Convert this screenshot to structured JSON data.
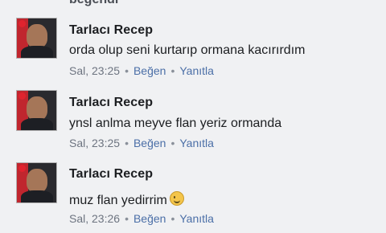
{
  "header_cut_text": "beğendi",
  "comments": [
    {
      "author": "Tarlacı Recep",
      "text": "orda olup seni kurtarıp ormana kacırırdım",
      "time": "Sal, 23:25",
      "like": "Beğen",
      "reply": "Yanıtla"
    },
    {
      "author": "Tarlacı Recep",
      "text": "ynsl anlma meyve flan yeriz ormanda",
      "time": "Sal, 23:25",
      "like": "Beğen",
      "reply": "Yanıtla"
    },
    {
      "author": "Tarlacı Recep",
      "text": "muz flan yedirrim",
      "emoji": "wink-emoji",
      "time": "Sal, 23:26",
      "like": "Beğen",
      "reply": "Yanıtla"
    }
  ],
  "colors": {
    "link": "#4b6fa7",
    "meta": "#6d7480",
    "name": "#1c1e21"
  }
}
